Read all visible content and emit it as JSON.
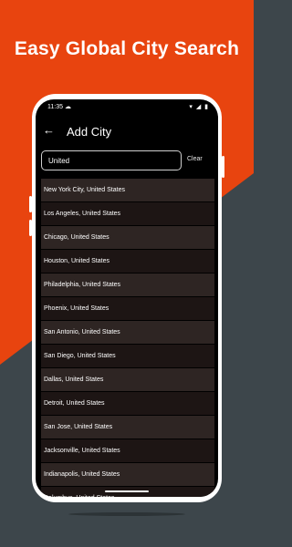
{
  "headline": "Easy Global City Search",
  "statusbar": {
    "time": "11:35",
    "cloud_icon": "cloud-icon",
    "right_icons": "▾ ◢ ▮"
  },
  "appbar": {
    "back_icon": "arrow-left-icon",
    "title": "Add City"
  },
  "search": {
    "value": "United",
    "placeholder": "",
    "clear_label": "Clear"
  },
  "results": [
    "New York City, United States",
    "Los Angeles, United States",
    "Chicago, United States",
    "Houston, United States",
    "Philadelphia, United States",
    "Phoenix, United States",
    "San Antonio, United States",
    "San Diego, United States",
    "Dallas, United States",
    "Detroit, United States",
    "San Jose, United States",
    "Jacksonville, United States",
    "Indianapolis, United States",
    "Columbus, United States"
  ],
  "colors": {
    "accent": "#e8440f",
    "background_dark": "#3d464b",
    "row_odd": "#2e2523",
    "row_even": "#1d1514"
  }
}
